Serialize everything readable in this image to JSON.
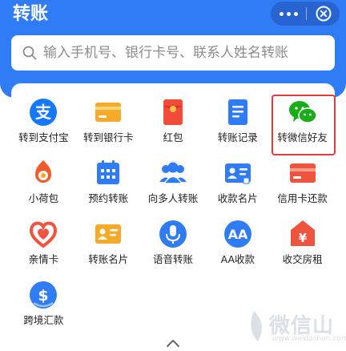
{
  "header": {
    "title": "转账"
  },
  "search": {
    "placeholder": "输入手机号、银行卡号、联系人姓名转账"
  },
  "colors": {
    "brand": "#2f7cf6",
    "highlight": "#e23b3b"
  },
  "grid": [
    {
      "label": "转到支付宝",
      "icon": "alipay-icon"
    },
    {
      "label": "转到银行卡",
      "icon": "bank-card-icon"
    },
    {
      "label": "红包",
      "icon": "red-envelope-icon"
    },
    {
      "label": "转账记录",
      "icon": "transfer-record-icon"
    },
    {
      "label": "转微信好友",
      "icon": "wechat-icon"
    },
    {
      "label": "小荷包",
      "icon": "purse-icon"
    },
    {
      "label": "预约转账",
      "icon": "calendar-icon"
    },
    {
      "label": "向多人转账",
      "icon": "group-icon"
    },
    {
      "label": "收款名片",
      "icon": "payment-card-icon"
    },
    {
      "label": "信用卡还款",
      "icon": "credit-card-icon"
    },
    {
      "label": "亲情卡",
      "icon": "family-card-icon"
    },
    {
      "label": "转账名片",
      "icon": "transfer-card-icon"
    },
    {
      "label": "语音转账",
      "icon": "microphone-icon"
    },
    {
      "label": "AA收款",
      "icon": "aa-collect-icon"
    },
    {
      "label": "收交房租",
      "icon": "rent-icon"
    },
    {
      "label": "跨境汇款",
      "icon": "cross-border-remit-icon"
    }
  ],
  "watermark": {
    "text": "微信山",
    "url": "www.weidashan.com"
  }
}
